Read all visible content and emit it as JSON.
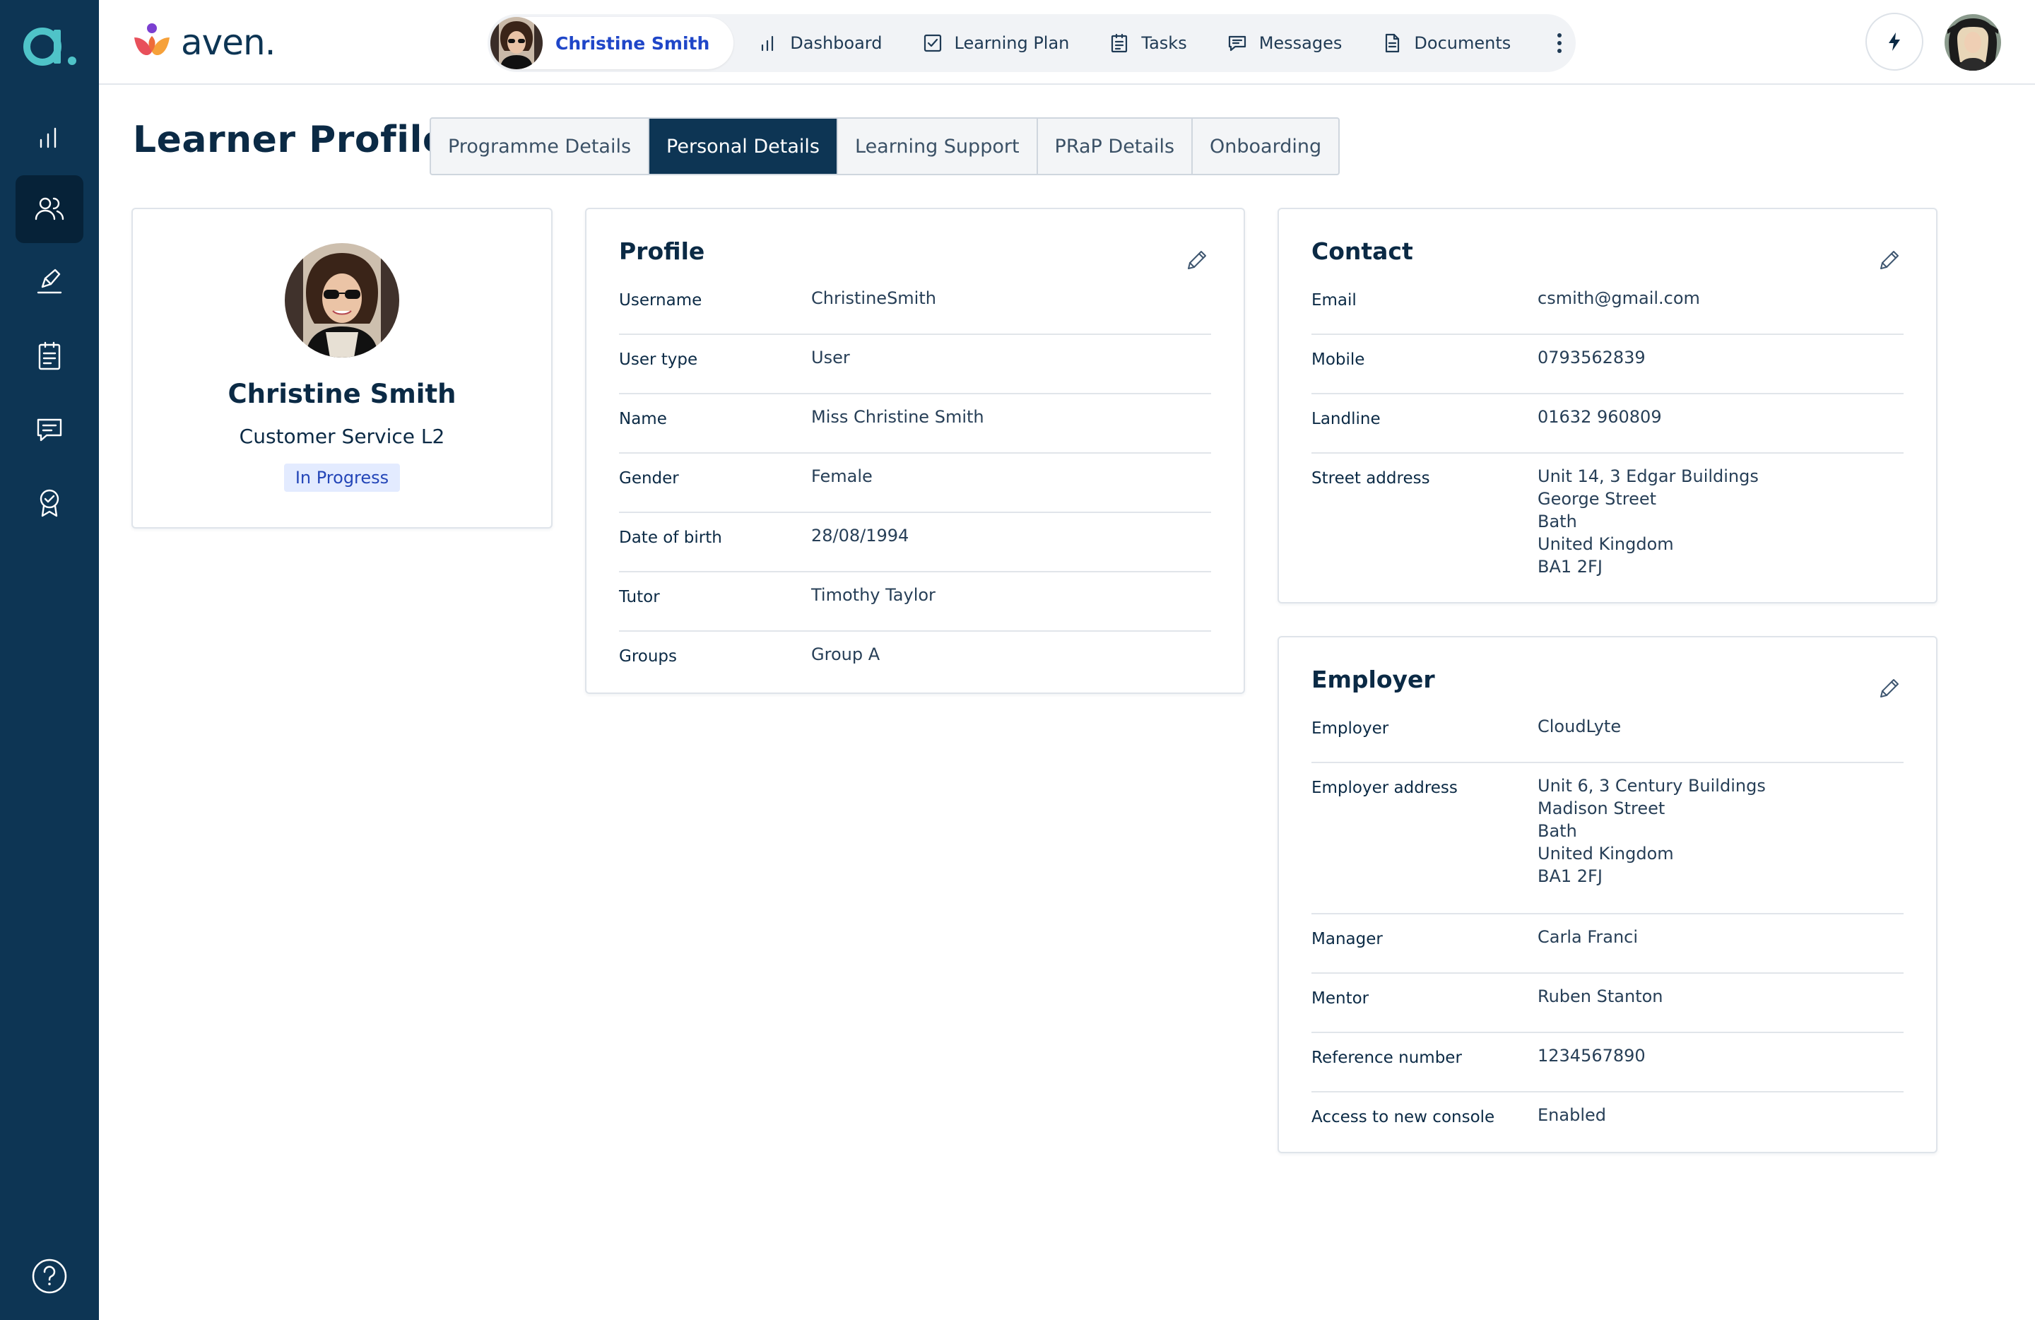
{
  "sidebar": {
    "logo_letter": "a",
    "items": [
      {
        "icon": "bar-chart-icon"
      },
      {
        "icon": "users-icon",
        "active": true
      },
      {
        "icon": "pen-sign-icon"
      },
      {
        "icon": "clipboard-icon"
      },
      {
        "icon": "chat-icon"
      },
      {
        "icon": "award-badge-icon"
      }
    ],
    "help_icon": "help-circle-icon"
  },
  "brand": {
    "name": "aven."
  },
  "nav": {
    "user_name": "Christine Smith",
    "items": [
      {
        "label": "Dashboard",
        "icon": "bar-chart-icon"
      },
      {
        "label": "Learning Plan",
        "icon": "checkbox-icon"
      },
      {
        "label": "Tasks",
        "icon": "clipboard-icon"
      },
      {
        "label": "Messages",
        "icon": "chat-icon"
      },
      {
        "label": "Documents",
        "icon": "document-icon"
      }
    ]
  },
  "page": {
    "title": "Learner Profile"
  },
  "tabs": [
    {
      "label": "Programme Details"
    },
    {
      "label": "Personal Details",
      "active": true
    },
    {
      "label": "Learning Support"
    },
    {
      "label": "PRaP Details"
    },
    {
      "label": "Onboarding"
    }
  ],
  "learner": {
    "name": "Christine Smith",
    "course": "Customer Service L2",
    "status": "In Progress"
  },
  "profile": {
    "title": "Profile",
    "rows": [
      {
        "label": "Username",
        "value": "ChristineSmith"
      },
      {
        "label": "User type",
        "value": "User"
      },
      {
        "label": "Name",
        "value": "Miss Christine Smith"
      },
      {
        "label": "Gender",
        "value": "Female"
      },
      {
        "label": "Date of birth",
        "value": "28/08/1994"
      },
      {
        "label": "Tutor",
        "value": "Timothy Taylor"
      },
      {
        "label": "Groups",
        "value": "Group A"
      }
    ]
  },
  "contact": {
    "title": "Contact",
    "email_label": "Email",
    "email": "csmith@gmail.com",
    "mobile_label": "Mobile",
    "mobile": "0793562839",
    "landline_label": "Landline",
    "landline": "01632 960809",
    "address_label": "Street address",
    "address": [
      "Unit 14, 3 Edgar Buildings",
      "George Street",
      "Bath",
      "United Kingdom",
      "BA1 2FJ"
    ]
  },
  "employer": {
    "title": "Employer",
    "employer_label": "Employer",
    "employer": "CloudLyte",
    "address_label": "Employer address",
    "address": [
      "Unit 6, 3 Century Buildings",
      "Madison Street",
      "Bath",
      "United Kingdom",
      "BA1 2FJ"
    ],
    "manager_label": "Manager",
    "manager": "Carla Franci",
    "mentor_label": "Mentor",
    "mentor": "Ruben Stanton",
    "reference_label": "Reference number",
    "reference": "1234567890",
    "console_label": "Access to new console",
    "console": "Enabled"
  },
  "colors": {
    "sidebar": "#0d3554",
    "accent_blue": "#1f46c8",
    "teal_logo": "#4fc3c8",
    "badge_bg": "#e3ebff"
  }
}
